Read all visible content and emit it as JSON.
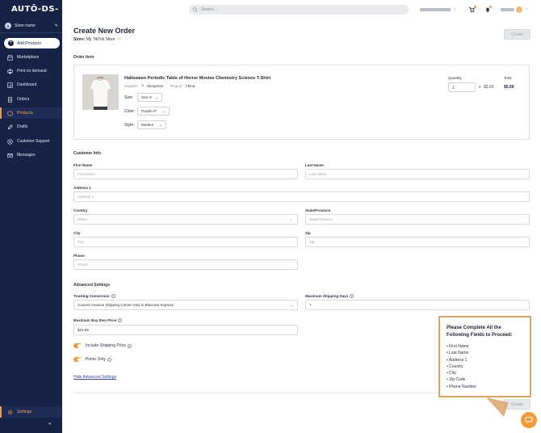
{
  "sidebar": {
    "logo": "AUTŌ-DS-",
    "store": {
      "avatar": "S",
      "name": "Store name"
    },
    "add_products": "Add Products",
    "items": [
      {
        "label": "Marketplace",
        "icon": "store-icon"
      },
      {
        "label": "Print on demand",
        "icon": "print-icon"
      },
      {
        "label": "Dashboard",
        "icon": "dashboard-icon"
      },
      {
        "label": "Orders",
        "icon": "orders-icon"
      },
      {
        "label": "Products",
        "icon": "products-icon",
        "active": true
      },
      {
        "label": "Drafts",
        "icon": "drafts-icon"
      },
      {
        "label": "Customer Support",
        "icon": "support-icon"
      },
      {
        "label": "Messages",
        "icon": "messages-icon"
      }
    ],
    "settings": "Settings",
    "collapse": "«"
  },
  "topbar": {
    "search_placeholder": "Search..."
  },
  "page": {
    "title": "Create New Order",
    "store_label": "Store:",
    "store_value": "My TikTok Store",
    "create_label": "Create"
  },
  "order_item": {
    "section": "Order Item",
    "product_title": "Halloween Periodic Table of Horror Movies Chemistry Science T-Shirt",
    "supplier_label": "Supplier:",
    "supplier_value": "Aliexpress",
    "region_label": "Region:",
    "region_value": "China",
    "size_label": "Size:",
    "size_value": "Size S",
    "color_label": "Color:",
    "color_value": "Purple 07",
    "style_label": "Style:",
    "style_value": "Modern",
    "quantity_label": "Quantity",
    "quantity_value": "1",
    "x": "x",
    "unit_price": "$5.69",
    "total_label": "Total",
    "total_value": "$5.69"
  },
  "customer_info": {
    "section": "Customer Info",
    "first_name_label": "First Name",
    "first_name_placeholder": "First Name",
    "last_name_label": "Last Name",
    "last_name_placeholder": "Last Name",
    "address_label": "Address 1",
    "address_placeholder": "Address 1",
    "country_label": "Country",
    "country_placeholder": "Select",
    "state_label": "State/Province",
    "state_placeholder": "State/Province",
    "city_label": "City",
    "city_placeholder": "City",
    "zip_label": "Zip",
    "zip_placeholder": "Zip",
    "phone_label": "Phone",
    "phone_placeholder": "Phone"
  },
  "advanced": {
    "section": "Advanced Settings",
    "tracking_label": "Tracking Conversion",
    "tracking_value": "Convert Amazon Shipping Carrier Only to Bluecare Express",
    "max_days_label": "Maximum Shipping Days",
    "max_days_value": "7",
    "max_price_label": "Maximum Buy Item Price",
    "max_price_value": "$15.89",
    "include_shipping": "Include Shipping Price",
    "prime_only": "Prime Only",
    "hide_link": "Hide Advanced Settings"
  },
  "callout": {
    "title": "Please Complete All the Following Fields to Proceed:",
    "items": [
      "First Name",
      "Last Name",
      "Address 1",
      "Country",
      "City",
      "Zip Code",
      "Phone Number"
    ]
  },
  "colors": {
    "sidebar": "#172346",
    "accent": "#f39a3a",
    "callout_border": "#d9a46e"
  }
}
